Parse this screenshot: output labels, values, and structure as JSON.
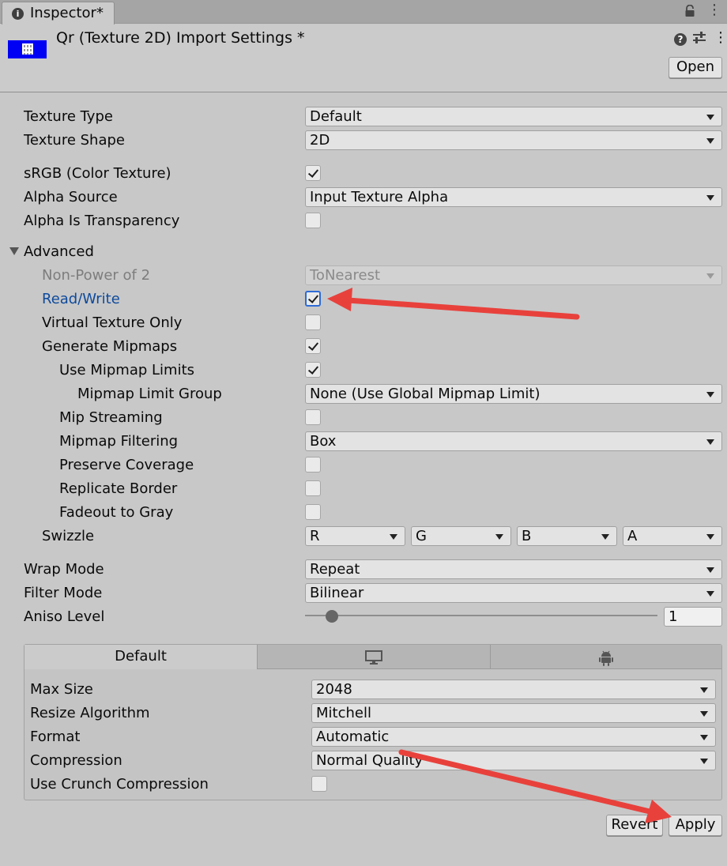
{
  "window": {
    "tab_title": "Inspector*"
  },
  "header": {
    "title": "Qr (Texture 2D) Import Settings *",
    "open_label": "Open"
  },
  "fields": {
    "texture_type": {
      "label": "Texture Type",
      "value": "Default"
    },
    "texture_shape": {
      "label": "Texture Shape",
      "value": "2D"
    },
    "srgb": {
      "label": "sRGB (Color Texture)",
      "checked": true
    },
    "alpha_source": {
      "label": "Alpha Source",
      "value": "Input Texture Alpha"
    },
    "alpha_is_transparency": {
      "label": "Alpha Is Transparency",
      "checked": false
    }
  },
  "advanced": {
    "label": "Advanced",
    "expanded": true,
    "non_power_of_2": {
      "label": "Non-Power of 2",
      "value": "ToNearest"
    },
    "read_write": {
      "label": "Read/Write",
      "checked": true
    },
    "virtual_texture_only": {
      "label": "Virtual Texture Only",
      "checked": false
    },
    "generate_mipmaps": {
      "label": "Generate Mipmaps",
      "checked": true
    },
    "use_mipmap_limits": {
      "label": "Use Mipmap Limits",
      "checked": true
    },
    "mipmap_limit_group": {
      "label": "Mipmap Limit Group",
      "value": "None (Use Global Mipmap Limit)"
    },
    "mip_streaming": {
      "label": "Mip Streaming",
      "checked": false
    },
    "mipmap_filtering": {
      "label": "Mipmap Filtering",
      "value": "Box"
    },
    "preserve_coverage": {
      "label": "Preserve Coverage",
      "checked": false
    },
    "replicate_border": {
      "label": "Replicate Border",
      "checked": false
    },
    "fadeout_to_gray": {
      "label": "Fadeout to Gray",
      "checked": false
    },
    "swizzle": {
      "label": "Swizzle",
      "r": "R",
      "g": "G",
      "b": "B",
      "a": "A"
    }
  },
  "sampling": {
    "wrap_mode": {
      "label": "Wrap Mode",
      "value": "Repeat"
    },
    "filter_mode": {
      "label": "Filter Mode",
      "value": "Bilinear"
    },
    "aniso_level": {
      "label": "Aniso Level",
      "value": "1",
      "slider_fraction": 0.06
    }
  },
  "platform": {
    "tabs": [
      {
        "label": "Default",
        "icon": null,
        "active": true
      },
      {
        "label": "",
        "icon": "monitor-icon",
        "active": false
      },
      {
        "label": "",
        "icon": "android-icon",
        "active": false
      }
    ],
    "max_size": {
      "label": "Max Size",
      "value": "2048"
    },
    "resize_algorithm": {
      "label": "Resize Algorithm",
      "value": "Mitchell"
    },
    "format": {
      "label": "Format",
      "value": "Automatic"
    },
    "compression": {
      "label": "Compression",
      "value": "Normal Quality"
    },
    "use_crunch": {
      "label": "Use Crunch Compression",
      "checked": false
    }
  },
  "footer": {
    "revert_label": "Revert",
    "apply_label": "Apply"
  },
  "annotation": {
    "arrow_color": "#e8413c"
  }
}
